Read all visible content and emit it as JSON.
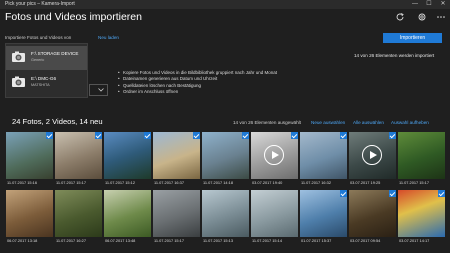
{
  "window": {
    "title": "Pick your pics – Kamera-Import",
    "minimize": "—",
    "maximize": "☐",
    "close": "✕"
  },
  "header": {
    "title": "Fotos und Videos importieren",
    "import_label": "Importieren"
  },
  "source": {
    "label": "Importiere Fotos und Videos von",
    "reload_link": "Neu laden"
  },
  "devices": [
    {
      "name": "F:\\ STORAGE DEVICE",
      "subtitle": "Generic",
      "selected": true
    },
    {
      "name": "E:\\ DMC-G6",
      "subtitle": "MATSHITA",
      "selected": false
    }
  ],
  "status": {
    "imported_count": "14 von 26 Elementen werden importiert"
  },
  "options": {
    "bullets": [
      "Kopiere Fotos und Videos in die Bildbibliothek gruppiert nach Jahr und Monat",
      "Dateinamen generieren aus Datum und Uhrzeit",
      "Quelldateien löschen nach Bestätigung",
      "Ordner im Anschluss öffnen"
    ]
  },
  "gallery": {
    "heading": "24 Fotos, 2 Videos, 14 neu",
    "selected_count": "14 von 26 Elementen ausgewählt",
    "select_new": "Neue auswählen",
    "select_all": "Alle auswählen",
    "deselect": "Auswahl aufheben",
    "tiles": [
      {
        "date": "11.07.2017 15:16",
        "checked": true,
        "video": false
      },
      {
        "date": "11.07.2017 15:17",
        "checked": true,
        "video": false
      },
      {
        "date": "11.07.2017 15:12",
        "checked": true,
        "video": false
      },
      {
        "date": "11.07.2017 16:37",
        "checked": true,
        "video": false
      },
      {
        "date": "11.07.2017 14:18",
        "checked": true,
        "video": false
      },
      {
        "date": "03.07.2017 19:40",
        "checked": true,
        "video": true
      },
      {
        "date": "11.07.2017 16:32",
        "checked": true,
        "video": false
      },
      {
        "date": "03.07.2017 19:25",
        "checked": true,
        "video": true
      },
      {
        "date": "11.07.2017 15:17",
        "checked": false,
        "video": false
      },
      {
        "date": "06.07.2017 13:18",
        "checked": false,
        "video": false
      },
      {
        "date": "11.07.2017 16:27",
        "checked": false,
        "video": false
      },
      {
        "date": "06.07.2017 13:48",
        "checked": false,
        "video": false
      },
      {
        "date": "11.07.2017 15:17",
        "checked": false,
        "video": false
      },
      {
        "date": "11.07.2017 15:13",
        "checked": false,
        "video": false
      },
      {
        "date": "11.07.2017 15:14",
        "checked": false,
        "video": false
      },
      {
        "date": "01.07.2017 15:37",
        "checked": true,
        "video": false
      },
      {
        "date": "03.07.2017 09:54",
        "checked": true,
        "video": false
      },
      {
        "date": "03.07.2017 14:17",
        "checked": true,
        "video": false
      }
    ]
  }
}
